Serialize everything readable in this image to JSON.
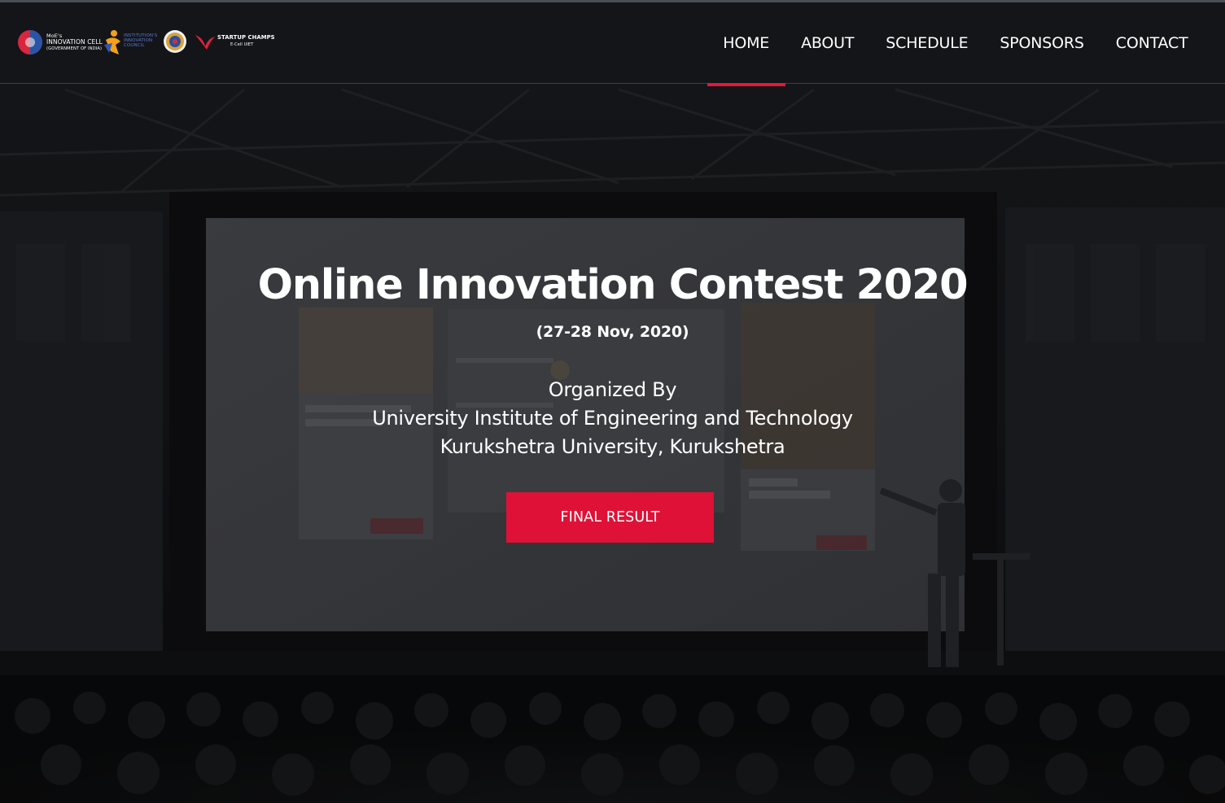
{
  "header": {
    "logos": [
      {
        "name": "moe-innovation-cell-logo",
        "lines": [
          "MoE's",
          "INNOVATION CELL",
          "(GOVERNMENT OF INDIA)"
        ]
      },
      {
        "name": "institution-innovation-council-logo",
        "lines": [
          "INSTITUTION'S",
          "INNOVATION",
          "COUNCIL"
        ]
      },
      {
        "name": "university-seal-logo"
      },
      {
        "name": "startup-champs-logo",
        "lines": [
          "STARTUP CHAMPS",
          "E-Cell UIET"
        ]
      }
    ],
    "nav": [
      {
        "label": "HOME",
        "active": true
      },
      {
        "label": "ABOUT",
        "active": false
      },
      {
        "label": "SCHEDULE",
        "active": false
      },
      {
        "label": "SPONSORS",
        "active": false
      },
      {
        "label": "CONTACT",
        "active": false
      }
    ]
  },
  "hero": {
    "title": "Online Innovation Contest 2020",
    "date": "(27-28 Nov, 2020)",
    "organized_by": "Organized By",
    "org_line1": "University Institute of Engineering and Technology",
    "org_line2": "Kurukshetra University, Kurukshetra",
    "button_label": "FINAL RESULT"
  },
  "colors": {
    "accent": "#df1137",
    "nav_active_bar": "#e4163a",
    "overlay": "#0d0e11"
  }
}
